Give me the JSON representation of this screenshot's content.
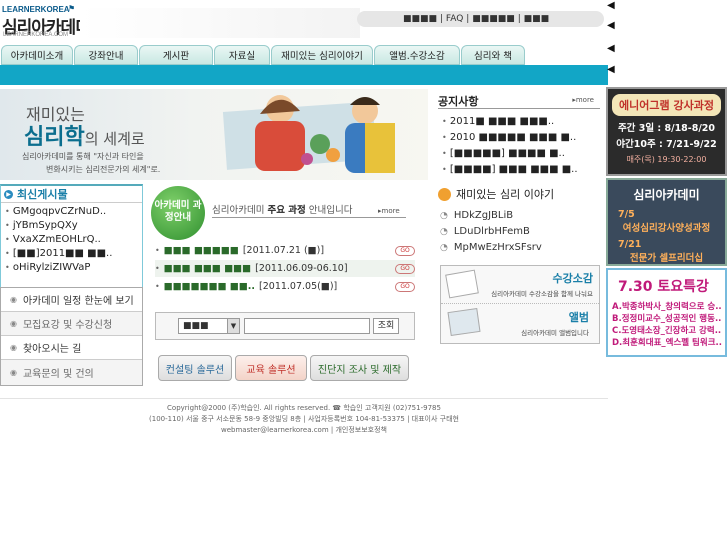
{
  "header": {
    "logo_en": "LEARNERKOREA",
    "logo_kr": "심리아카데미",
    "logo_sub": "LEARNERKOREA.COM",
    "top_links": [
      "■■■■",
      "| FAQ |",
      "■■■■■",
      "| ■■■"
    ]
  },
  "nav": {
    "tabs": [
      "아카데미소개",
      "강좌안내",
      "게시판",
      "자료실",
      "재미있는 심리이야기",
      "앨범.수강소감",
      "심리와 책"
    ]
  },
  "banner": {
    "line1": "재미있는",
    "line2": "심리학",
    "line2b": "의 세계로",
    "desc1": "심리아카데미를 통해 \"자신과 타인을",
    "desc2": "변화시키는 심리전문가의 세계\"로."
  },
  "notice": {
    "title": "공지사항",
    "more": "more",
    "items": [
      "2011■ ■■■ ■■■..",
      "2010 ■■■■■ ■■■ ■..",
      "[■■■■■] ■■■■ ■..",
      "[■■■■] ■■■ ■■■ ■.."
    ]
  },
  "recent": {
    "title": "최신게시물",
    "items": [
      "GMgoqpvCZrNuD..",
      "jYBmSypQXy",
      "VxaXZmEOHLrQ..",
      "[■■]2011■■ ■■..",
      "oHiRylziZIWVaP"
    ]
  },
  "quick_menu": {
    "items": [
      "아카데미 일정 한눈에 보기",
      "모집요강 및 수강신청",
      "찾아오시는 길",
      "교육문의 및 건의"
    ]
  },
  "courses": {
    "circle": "아카데미 과정안내",
    "title_pre": "심리아카데미 ",
    "title_bold": "주요 과정",
    "title_post": " 안내입니다",
    "more": "more",
    "go": "GO",
    "rows": [
      {
        "name": "■■■ ■■■■■",
        "date": "[2011.07.21 (■)]"
      },
      {
        "name": "■■■ ■■■ ■■■",
        "date": "[2011.06.09-06.10]"
      },
      {
        "name": "■■■■■■■ ■■..",
        "date": "[2011.07.05(■)]"
      }
    ]
  },
  "search": {
    "select": "■■■",
    "button": "조회"
  },
  "solutions": [
    "컨설팅 솔루션",
    "교육 솔루션",
    "진단지 조사 및 제작"
  ],
  "story": {
    "title": "재미있는 심리 이야기",
    "items": [
      "HDkZgJBLiB",
      "LDuDlrbHFemB",
      "MpMwEzHrxSFsrv"
    ]
  },
  "album": {
    "t1": "수강소감",
    "d1": "심리아카데미 수강소감을 함께 나눠요",
    "t2": "앨범",
    "d2": "심리아카데미 앨범입니다"
  },
  "side1": {
    "title": "에니어그램 강사과정",
    "l1": "주간 3일 : 8/18-8/20",
    "l2": "야간10주 : 7/21-9/22",
    "l3": "매주(목) 19:30-22:00"
  },
  "side2": {
    "title": "심리아카데미",
    "l1": "7/5",
    "l2": "여성심리강사양성과정",
    "l3": "7/21",
    "l4": "전문가 셀프리더십"
  },
  "side3": {
    "title": "7.30 토요특강",
    "l1": "A.박종하박사_창의력으로 승..",
    "l2": "B.정정미교수_성공적인 행동..",
    "l3": "C.도영태소장_긴장하고 강력..",
    "l4": "D.최훈희대표_엑스펠 팀워크.."
  },
  "side_arrows": [
    "◀",
    "◀",
    "◀",
    "◀"
  ],
  "footer": {
    "l1": "Copyright@2000 (주)학습인.  All rights reserved.  ☎ 학습인 고객지원 (02)751-9785",
    "l2": "(100-110) 서울 중구 서소문동 58-9 중앙빌딩 8층 | 사업자등록번호 104-81-53375 | 대표이사 구태현",
    "l3": "webmaster@learnerkorea.com    |   개인정보보호정책"
  }
}
